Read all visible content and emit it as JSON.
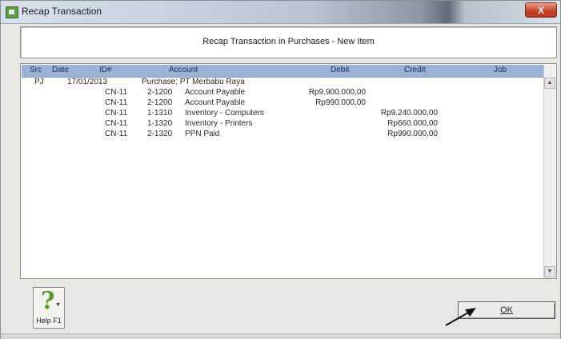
{
  "window": {
    "title": "Recap Transaction",
    "close_label": "X"
  },
  "heading": "Recap Transaction in Purchases - New Item",
  "grid": {
    "columns": [
      "Src",
      "Date",
      "ID#",
      "Account",
      "Debit",
      "Credit",
      "Job"
    ],
    "rows": [
      {
        "src": "PJ",
        "date": "17/01/2013",
        "id": "",
        "account_no": "",
        "account": "Purchase; PT Merbabu Raya",
        "debit": "",
        "credit": ""
      },
      {
        "src": "",
        "date": "",
        "id": "CN-11",
        "account_no": "2-1200",
        "account": "Account Payable",
        "debit": "Rp9.900.000,00",
        "credit": ""
      },
      {
        "src": "",
        "date": "",
        "id": "CN-11",
        "account_no": "2-1200",
        "account": "Account Payable",
        "debit": "Rp990.000,00",
        "credit": ""
      },
      {
        "src": "",
        "date": "",
        "id": "CN-11",
        "account_no": "1-1310",
        "account": "Inventory - Computers",
        "debit": "",
        "credit": "Rp9.240.000,00"
      },
      {
        "src": "",
        "date": "",
        "id": "CN-11",
        "account_no": "1-1320",
        "account": "Inventory - Printers",
        "debit": "",
        "credit": "Rp660.000,00"
      },
      {
        "src": "",
        "date": "",
        "id": "CN-11",
        "account_no": "2-1320",
        "account": "PPN Paid",
        "debit": "",
        "credit": "Rp990.000,00"
      }
    ]
  },
  "help_button": {
    "label": "Help F1",
    "icon": "question-mark-icon"
  },
  "ok_button": {
    "label": "OK"
  },
  "colors": {
    "header_bg": "#9bb3d6",
    "window_bg": "#e9e7e2",
    "help_icon": "#5a9b2c"
  }
}
